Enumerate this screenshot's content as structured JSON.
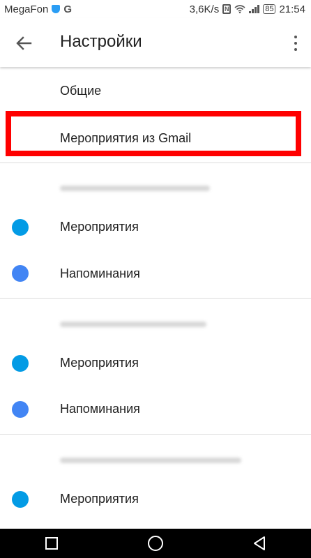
{
  "status_bar": {
    "carrier": "MegaFon",
    "speed": "3,6K/s",
    "battery": "85",
    "time": "21:54"
  },
  "app_bar": {
    "title": "Настройки"
  },
  "settings": {
    "general": "Общие",
    "gmail_events": "Мероприятия из Gmail"
  },
  "accounts": [
    {
      "email": "",
      "items": [
        {
          "label": "Мероприятия",
          "color": "#039be5"
        },
        {
          "label": "Напоминания",
          "color": "#4285f4"
        }
      ]
    },
    {
      "email": "",
      "items": [
        {
          "label": "Мероприятия",
          "color": "#039be5"
        },
        {
          "label": "Напоминания",
          "color": "#4285f4"
        }
      ]
    },
    {
      "email": "",
      "items": [
        {
          "label": "Мероприятия",
          "color": "#039be5"
        }
      ]
    }
  ],
  "colors": {
    "highlight": "#ff0000",
    "events_dot": "#039be5",
    "reminders_dot": "#4285f4"
  }
}
